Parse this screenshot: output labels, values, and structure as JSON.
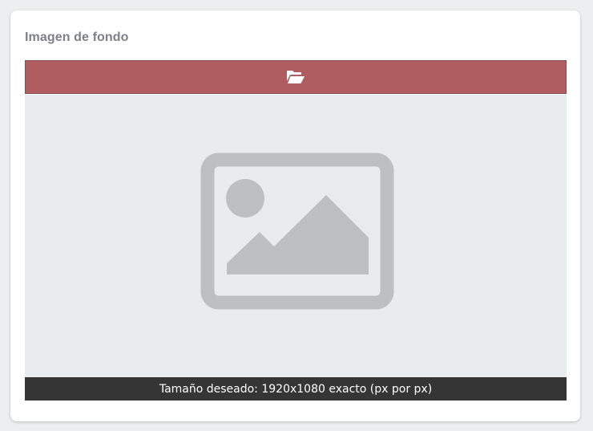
{
  "panel": {
    "title": "Imagen de fondo"
  },
  "upload": {
    "icon": "folder-open-icon",
    "button_color": "#b05d61"
  },
  "preview": {
    "icon": "image-placeholder-icon",
    "background_color": "#e8ecef"
  },
  "caption": {
    "text": "Tamaño deseado: 1920x1080 exacto (px por px)"
  }
}
